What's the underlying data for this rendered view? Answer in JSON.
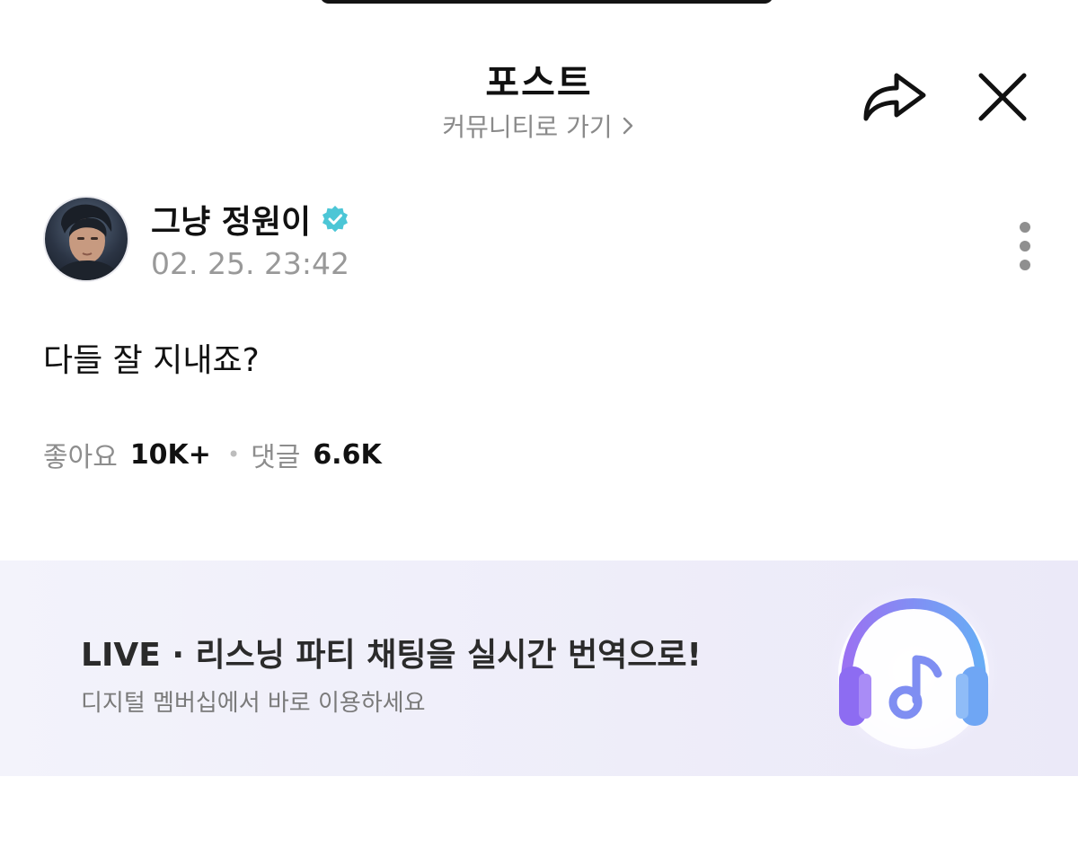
{
  "header": {
    "title": "포스트",
    "community_link": "커뮤니티로 가기",
    "share_icon": "share-icon",
    "close_icon": "close-icon"
  },
  "post": {
    "author_name": "그냥 정원이",
    "verified_icon": "verified-badge-icon",
    "timestamp": "02. 25. 23:42",
    "more_icon": "more-vertical-icon",
    "body": "다들 잘 지내죠?",
    "likes_label": "좋아요",
    "likes_count": "10K+",
    "comments_label": "댓글",
    "comments_count": "6.6K"
  },
  "banner": {
    "title": "LIVE · 리스닝 파티 채팅을 실시간 번역으로!",
    "subtitle": "디지털 멤버십에서 바로 이용하세요",
    "art_icon": "headphones-music-icon"
  },
  "colors": {
    "verified": "#4cc6d6",
    "muted_text": "#8a8a8a",
    "banner_bg": "#efeefa",
    "headphone_purple": "#8d6cf2",
    "headphone_blue": "#6fa6f4"
  }
}
